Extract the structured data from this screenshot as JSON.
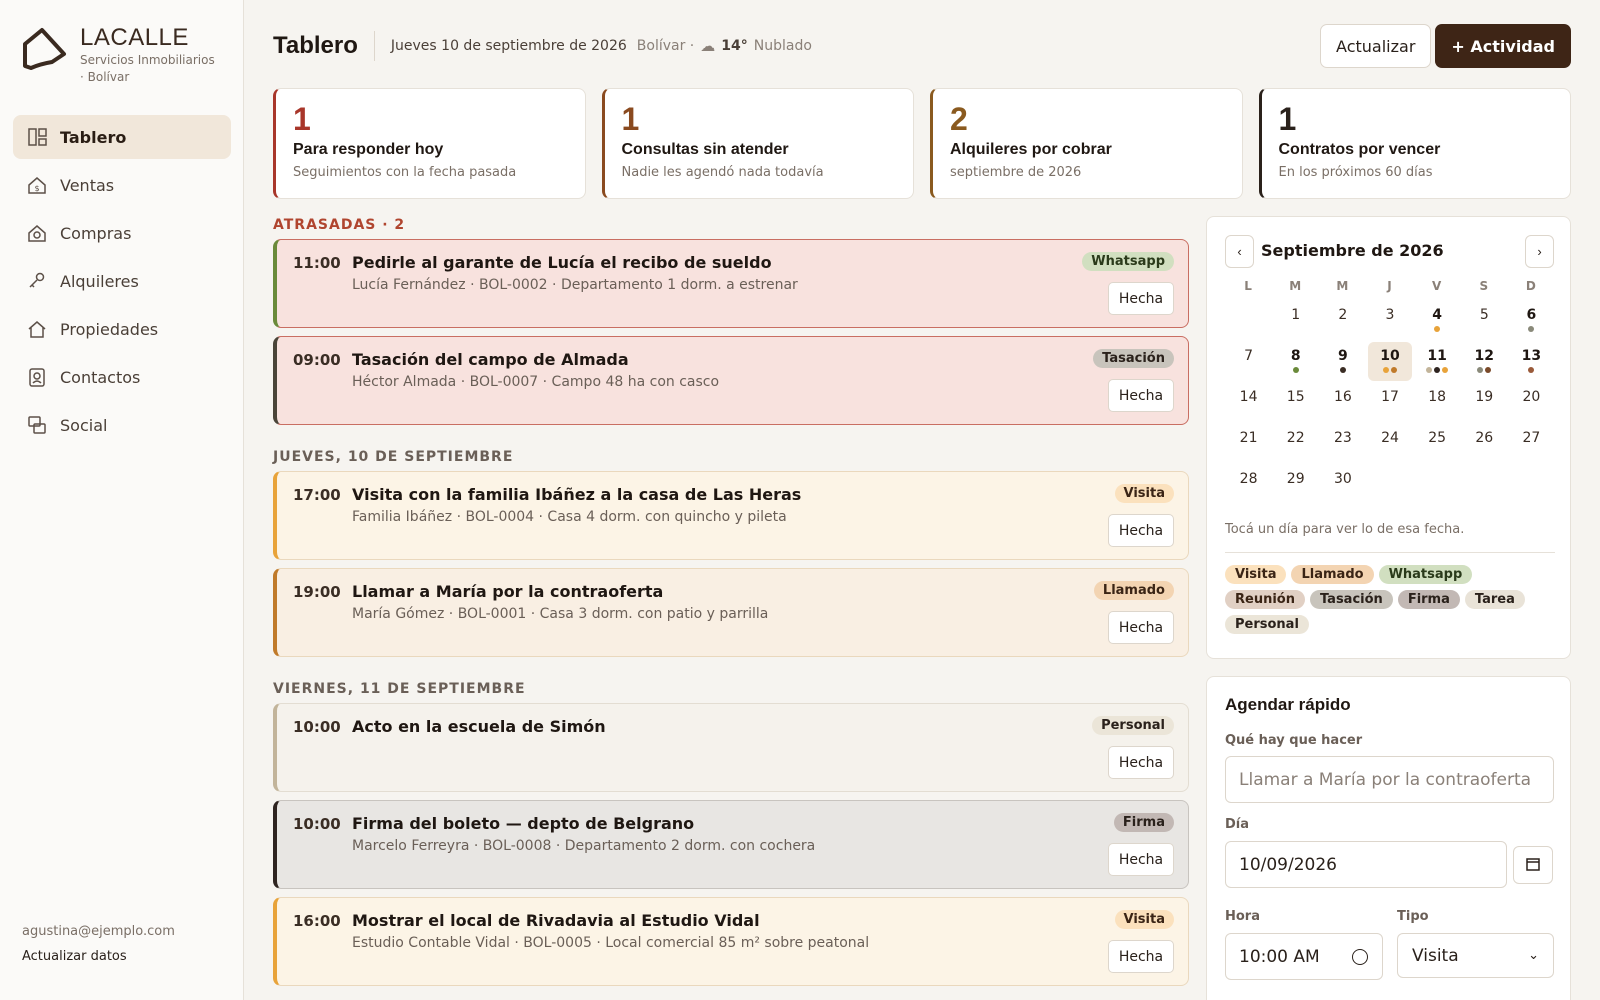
{
  "brand": {
    "name": "LACALLE",
    "subtitle": "Servicios Inmobiliarios · Bolívar"
  },
  "nav": [
    {
      "label": "Tablero",
      "icon": "dashboard-icon",
      "active": true
    },
    {
      "label": "Ventas",
      "icon": "house-sale-icon"
    },
    {
      "label": "Compras",
      "icon": "house-search-icon"
    },
    {
      "label": "Alquileres",
      "icon": "key-hand-icon"
    },
    {
      "label": "Propiedades",
      "icon": "home-icon"
    },
    {
      "label": "Contactos",
      "icon": "contact-book-icon"
    },
    {
      "label": "Social",
      "icon": "social-chat-icon"
    }
  ],
  "footer": {
    "email": "agustina@ejemplo.com",
    "update": "Actualizar datos"
  },
  "header": {
    "title": "Tablero",
    "date": "Jueves 10 de septiembre de 2026",
    "location": "Bolívar ·",
    "weather_icon": "☁",
    "temp": "14°",
    "weather": "Nublado",
    "refresh": "Actualizar",
    "add": "+ Actividad"
  },
  "stats": [
    {
      "value": "1",
      "label": "Para responder hoy",
      "sub": "Seguimientos con la fecha pasada",
      "color": "#a8362a"
    },
    {
      "value": "1",
      "label": "Consultas sin atender",
      "sub": "Nadie les agendó nada todavía",
      "color": "#8a4a1f"
    },
    {
      "value": "2",
      "label": "Alquileres por cobrar",
      "sub": "septiembre de 2026",
      "color": "#8a5a1f"
    },
    {
      "value": "1",
      "label": "Contratos por vencer",
      "sub": "En los próximos 60 días",
      "color": "#2a211b"
    }
  ],
  "sections": [
    {
      "title": "ATRASADAS · 2",
      "late": true,
      "cards": [
        {
          "time": "11:00",
          "title": "Pedirle al garante de Lucía el recibo de sueldo",
          "sub": "Lucía Fernández · BOL-0002 · Departamento 1 dorm. a estrenar",
          "tag": "Whatsapp",
          "tag_class": "tag-whatsapp",
          "bg": "#f8e2de",
          "border": "#c96e62",
          "accent": "#6a8a3a"
        },
        {
          "time": "09:00",
          "title": "Tasación del campo de Almada",
          "sub": "Héctor Almada · BOL-0007 · Campo 48 ha con casco",
          "tag": "Tasación",
          "tag_class": "tag-tasacion",
          "bg": "#f8e2de",
          "border": "#c96e62",
          "accent": "#4a4438"
        }
      ]
    },
    {
      "title": "JUEVES, 10 DE SEPTIEMBRE",
      "late": false,
      "cards": [
        {
          "time": "17:00",
          "title": "Visita con la familia Ibáñez a la casa de Las Heras",
          "sub": "Familia Ibáñez · BOL-0004 · Casa 4 dorm. con quincho y pileta",
          "tag": "Visita",
          "tag_class": "tag-visita",
          "bg": "#fcf4e6",
          "border": "#ead8bd",
          "accent": "#e8a33a"
        },
        {
          "time": "19:00",
          "title": "Llamar a María por la contraoferta",
          "sub": "María Gómez · BOL-0001 · Casa 3 dorm. con patio y parrilla",
          "tag": "Llamado",
          "tag_class": "tag-llamado",
          "bg": "#f9efe3",
          "border": "#ead8bd",
          "accent": "#c07a2a"
        }
      ]
    },
    {
      "title": "VIERNES, 11 DE SEPTIEMBRE",
      "late": false,
      "cards": [
        {
          "time": "10:00",
          "title": "Acto en la escuela de Simón",
          "sub": "",
          "tag": "Personal",
          "tag_class": "tag-personal",
          "bg": "#f5f2ec",
          "border": "#e3ddd2",
          "accent": "#c2b49a"
        },
        {
          "time": "10:00",
          "title": "Firma del boleto — depto de Belgrano",
          "sub": "Marcelo Ferreyra · BOL-0008 · Departamento 2 dorm. con cochera",
          "tag": "Firma",
          "tag_class": "tag-firma",
          "bg": "#e8e6e3",
          "border": "#c8c4bf",
          "accent": "#2e2420"
        },
        {
          "time": "16:00",
          "title": "Mostrar el local de Rivadavia al Estudio Vidal",
          "sub": "Estudio Contable Vidal · BOL-0005 · Local comercial 85 m² sobre peatonal",
          "tag": "Visita",
          "tag_class": "tag-visita",
          "bg": "#fcf4e6",
          "border": "#ead8bd",
          "accent": "#e8a33a"
        }
      ]
    }
  ],
  "done_label": "Hecha",
  "calendar": {
    "title": "Septiembre de 2026",
    "prev": "‹",
    "next": "›",
    "dows": [
      "L",
      "M",
      "M",
      "J",
      "V",
      "S",
      "D"
    ],
    "offset": 1,
    "days": [
      {
        "d": "1"
      },
      {
        "d": "2"
      },
      {
        "d": "3"
      },
      {
        "d": "4",
        "bold": true,
        "dots": [
          "#e8a33a"
        ]
      },
      {
        "d": "5"
      },
      {
        "d": "6",
        "bold": true,
        "dots": [
          "#8a8a7a"
        ]
      },
      {
        "d": "7"
      },
      {
        "d": "8",
        "bold": true,
        "dots": [
          "#6a8a3a"
        ]
      },
      {
        "d": "9",
        "bold": true,
        "dots": [
          "#3a2d24"
        ]
      },
      {
        "d": "10",
        "bold": true,
        "today": true,
        "dots": [
          "#e8a33a",
          "#c07a2a"
        ]
      },
      {
        "d": "11",
        "bold": true,
        "dots": [
          "#c2b49a",
          "#2e2420",
          "#e8a33a"
        ]
      },
      {
        "d": "12",
        "bold": true,
        "dots": [
          "#8a8a7a",
          "#7a4a2a"
        ]
      },
      {
        "d": "13",
        "bold": true,
        "dots": [
          "#9a5a3a"
        ]
      },
      {
        "d": "14"
      },
      {
        "d": "15"
      },
      {
        "d": "16"
      },
      {
        "d": "17"
      },
      {
        "d": "18"
      },
      {
        "d": "19"
      },
      {
        "d": "20"
      },
      {
        "d": "21"
      },
      {
        "d": "22"
      },
      {
        "d": "23"
      },
      {
        "d": "24"
      },
      {
        "d": "25"
      },
      {
        "d": "26"
      },
      {
        "d": "27"
      },
      {
        "d": "28"
      },
      {
        "d": "29"
      },
      {
        "d": "30"
      }
    ],
    "hint": "Tocá un día para ver lo de esa fecha.",
    "legend": [
      {
        "label": "Visita",
        "cls": "tag-visita"
      },
      {
        "label": "Llamado",
        "cls": "tag-llamado"
      },
      {
        "label": "Whatsapp",
        "cls": "tag-whatsapp"
      },
      {
        "label": "Reunión",
        "cls": "tag-reunion"
      },
      {
        "label": "Tasación",
        "cls": "tag-tasacion"
      },
      {
        "label": "Firma",
        "cls": "tag-firma"
      },
      {
        "label": "Tarea",
        "cls": "tag-tarea"
      },
      {
        "label": "Personal",
        "cls": "tag-personal"
      }
    ]
  },
  "quick": {
    "title": "Agendar rápido",
    "what_label": "Qué hay que hacer",
    "what_placeholder": "Llamar a María por la contraoferta",
    "day_label": "Día",
    "day_value": "10/09/2026",
    "hour_label": "Hora",
    "hour_value": "10:00 AM",
    "type_label": "Tipo",
    "type_value": "Visita"
  }
}
